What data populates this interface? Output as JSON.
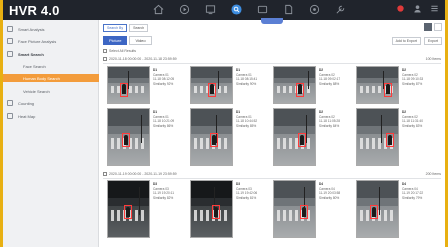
{
  "app": {
    "title": "HVR 4.0"
  },
  "topbar": {
    "icons": [
      "home-icon",
      "playback-icon",
      "monitor-icon",
      "search-icon",
      "storage-icon",
      "file-icon",
      "settings-icon",
      "maintenance-icon"
    ],
    "right_icons": [
      "alarm-icon",
      "user-icon",
      "menu-icon"
    ]
  },
  "sidebar": {
    "items": [
      {
        "label": "Smart Analysis",
        "type": "item"
      },
      {
        "label": "Face Picture Analysis",
        "type": "item"
      },
      {
        "label": "Smart Search",
        "type": "group"
      },
      {
        "label": "Face Search",
        "type": "sub"
      },
      {
        "label": "Human Body Search",
        "type": "sub-active"
      },
      {
        "label": "Vehicle Search",
        "type": "sub"
      },
      {
        "label": "Counting",
        "type": "item"
      },
      {
        "label": "Heat Map",
        "type": "item"
      }
    ]
  },
  "toolbar": {
    "chips": [
      "Search By",
      "Search"
    ],
    "tabs": [
      "Picture",
      "Video"
    ],
    "right_actions": [
      "Add to Export",
      "Export"
    ]
  },
  "groups": [
    {
      "select_all": "Select All Results",
      "header": "2020-11-18 00:00:00 - 2020-11-18 23:59:59",
      "count": "100 Items"
    },
    {
      "header": "2020-11-19 00:00:00 - 2020-11-19 23:59:59",
      "count": "200 Items"
    }
  ],
  "results": [
    {
      "index": "D1",
      "camera": "Camera 01",
      "time": "11-18 08:12:05",
      "score": "Similarity 92%",
      "night": false
    },
    {
      "index": "D1",
      "camera": "Camera 01",
      "time": "11-18 08:15:41",
      "score": "Similarity 90%",
      "night": false
    },
    {
      "index": "D2",
      "camera": "Camera 02",
      "time": "11-18 09:02:17",
      "score": "Similarity 88%",
      "night": false
    },
    {
      "index": "D2",
      "camera": "Camera 02",
      "time": "11-18 09:10:33",
      "score": "Similarity 87%",
      "night": false
    },
    {
      "index": "D1",
      "camera": "Camera 01",
      "time": "11-18 10:21:09",
      "score": "Similarity 86%",
      "night": false
    },
    {
      "index": "D1",
      "camera": "Camera 01",
      "time": "11-18 10:44:52",
      "score": "Similarity 85%",
      "night": false
    },
    {
      "index": "D2",
      "camera": "Camera 02",
      "time": "11-18 11:05:28",
      "score": "Similarity 84%",
      "night": false
    },
    {
      "index": "D2",
      "camera": "Camera 02",
      "time": "11-18 11:31:40",
      "score": "Similarity 83%",
      "night": false
    },
    {
      "index": "D3",
      "camera": "Camera 03",
      "time": "11-19 19:20:11",
      "score": "Similarity 82%",
      "night": true
    },
    {
      "index": "D3",
      "camera": "Camera 03",
      "time": "11-19 19:42:06",
      "score": "Similarity 81%",
      "night": true
    },
    {
      "index": "D4",
      "camera": "Camera 04",
      "time": "11-19 20:03:58",
      "score": "Similarity 80%",
      "night": false
    },
    {
      "index": "D4",
      "camera": "Camera 04",
      "time": "11-19 20:17:22",
      "score": "Similarity 79%",
      "night": false
    }
  ],
  "colors": {
    "frame": "#e8b012",
    "topbar": "#20242c",
    "accent": "#3d66c4",
    "active_nav": "#f39c3b",
    "detection_box": "#ff3b3b"
  }
}
